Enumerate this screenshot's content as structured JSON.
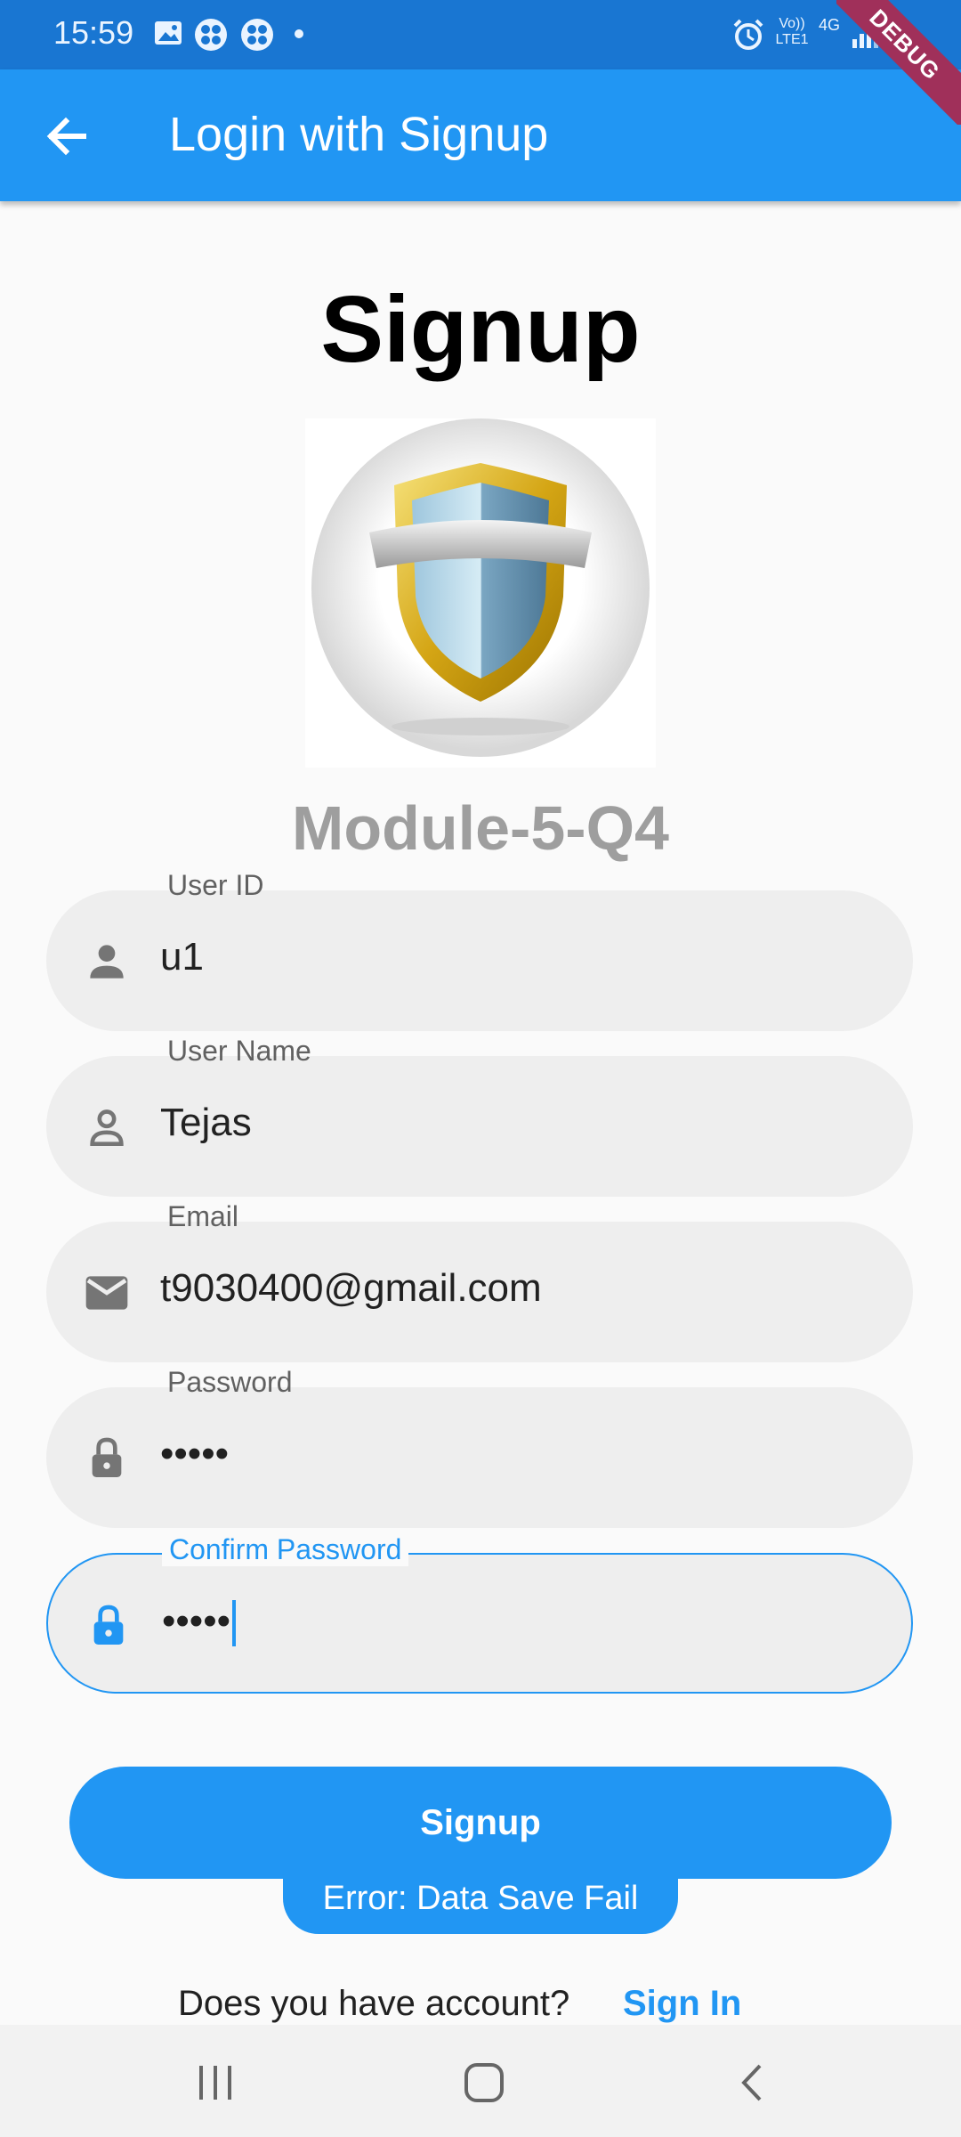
{
  "status_bar": {
    "time": "15:59",
    "right_icons": [
      "alarm-icon",
      "volte-icon",
      "4g-icon",
      "signal-icon",
      "battery-icon"
    ],
    "network_label": "Vo)) LTE1",
    "network_type": "4G"
  },
  "debug_banner": "DEBUG",
  "app_bar": {
    "title": "Login with Signup",
    "back_icon": "arrow-back-icon"
  },
  "page": {
    "heading": "Signup",
    "subtitle": "Module-5-Q4"
  },
  "form": {
    "fields": [
      {
        "label": "User ID",
        "value": "u1",
        "icon": "person-icon"
      },
      {
        "label": "User Name",
        "value": "Tejas",
        "icon": "person-outline-icon"
      },
      {
        "label": "Email",
        "value": "t9030400@gmail.com",
        "icon": "email-icon"
      },
      {
        "label": "Password",
        "value": "•••••",
        "icon": "lock-icon"
      },
      {
        "label": "Confirm Password",
        "value": "•••••",
        "icon": "lock-icon",
        "focused": true
      }
    ],
    "submit_label": "Signup"
  },
  "snackbar": {
    "message": "Error: Data Save Fail"
  },
  "footer": {
    "question": "Does you have account?",
    "link_label": "Sign In"
  },
  "colors": {
    "primary": "#2196f3",
    "status_bar": "#1976d2",
    "field_fill": "#eeeeee",
    "subtitle_grey": "#9e9e9e"
  }
}
